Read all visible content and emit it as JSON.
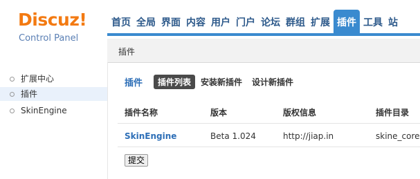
{
  "logo": {
    "brand": "Discuz!",
    "subtitle": "Control Panel"
  },
  "nav": {
    "items": [
      "首页",
      "全局",
      "界面",
      "内容",
      "用户",
      "门户",
      "论坛",
      "群组",
      "扩展",
      "插件",
      "工具",
      "站"
    ],
    "active": "插件"
  },
  "breadcrumb": "插件",
  "sidebar": {
    "items": [
      "扩展中心",
      "插件",
      "SkinEngine"
    ],
    "active_index": 1
  },
  "main": {
    "page_title": "插件",
    "tabs": [
      "插件列表",
      "安装新插件",
      "设计新插件"
    ],
    "active_tab_index": 0,
    "table": {
      "headers": [
        "插件名称",
        "版本",
        "版权信息",
        "插件目录"
      ],
      "rows": [
        [
          "SkinEngine",
          "Beta 1.024",
          "http://jiap.in",
          "skine_core"
        ]
      ]
    },
    "submit_label": "提交"
  },
  "colors": {
    "accent": "#3a8acf",
    "brand": "#f37a12",
    "link": "#2e6fb7"
  }
}
